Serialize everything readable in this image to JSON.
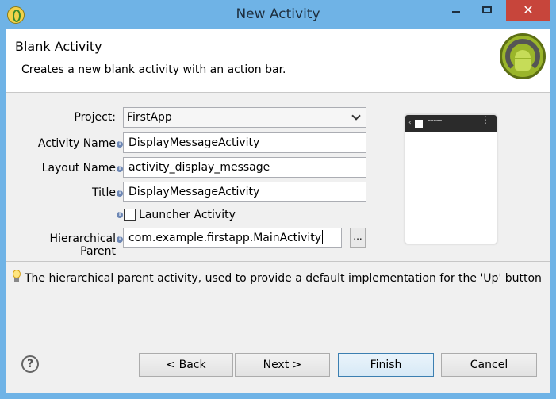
{
  "window": {
    "title": "New Activity",
    "close_glyph": "✕"
  },
  "banner": {
    "title": "Blank Activity",
    "description": "Creates a new blank activity with an action bar."
  },
  "form": {
    "project_label": "Project:",
    "project_value": "FirstApp",
    "activity_name_label": "Activity Name",
    "activity_name_value": "DisplayMessageActivity",
    "layout_name_label": "Layout Name",
    "layout_name_value": "activity_display_message",
    "title_label": "Title",
    "title_value": "DisplayMessageActivity",
    "launcher_label": "Launcher Activity",
    "launcher_checked": false,
    "parent_label": "Hierarchical Parent",
    "parent_value": "com.example.firstapp.MainActivity",
    "browse_label": "...",
    "info_glyph": "i"
  },
  "hint": {
    "text": "The hierarchical parent activity, used to provide a default implementation for the 'Up' button"
  },
  "buttons": {
    "help": "?",
    "back": "< Back",
    "next": "Next >",
    "finish": "Finish",
    "cancel": "Cancel"
  },
  "preview": {
    "back_glyph": "‹",
    "title_glyph": "ᵔᵔᵔᵔᵔ",
    "menu_glyph": "⋮"
  },
  "icons": {
    "app": "eclipse-icon",
    "logo": "android-logo-icon",
    "hint": "lightbulb-icon"
  },
  "colors": {
    "titlebar": "#6fb3e6",
    "close": "#c7453b"
  }
}
